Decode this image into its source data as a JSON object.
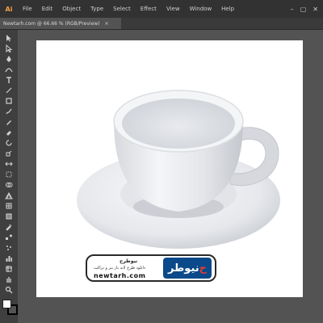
{
  "menubar": {
    "app_logo": "Ai",
    "items": [
      "File",
      "Edit",
      "Object",
      "Type",
      "Select",
      "Effect",
      "View",
      "Window",
      "Help"
    ],
    "window_controls": [
      "minimize-icon",
      "maximize-icon",
      "close-icon"
    ]
  },
  "document_tab": {
    "title": "Newtarh.com @ 66.66 % (RGB/Preview)",
    "close": "×"
  },
  "tools": [
    "selection-tool-icon",
    "direct-selection-tool-icon",
    "pen-tool-icon",
    "curvature-tool-icon",
    "type-tool-icon",
    "line-tool-icon",
    "rectangle-tool-icon",
    "paintbrush-tool-icon",
    "pencil-tool-icon",
    "eraser-tool-icon",
    "rotate-tool-icon",
    "scale-tool-icon",
    "width-tool-icon",
    "free-transform-tool-icon",
    "shape-builder-tool-icon",
    "perspective-grid-tool-icon",
    "mesh-tool-icon",
    "gradient-tool-icon",
    "eyedropper-tool-icon",
    "blend-tool-icon",
    "symbol-sprayer-tool-icon",
    "column-graph-tool-icon",
    "artboard-tool-icon",
    "slice-tool-icon",
    "hand-tool-icon",
    "zoom-tool-icon"
  ],
  "colors": {
    "accent": "#f3a14b",
    "canvas": "#535353",
    "artboard": "#ffffff",
    "fill_swatch": "#ffffff",
    "stroke_swatch": "#000000",
    "watermark_brand": "#0a4a8a",
    "watermark_accent": "#e53935"
  },
  "watermark": {
    "logo_text_main": "نیوطر",
    "logo_text_accent": "ح",
    "title": "نیوطرح",
    "subtitle": "دانلود طرح لایه باز بنر و تراکت",
    "url": "newtarh.com"
  }
}
